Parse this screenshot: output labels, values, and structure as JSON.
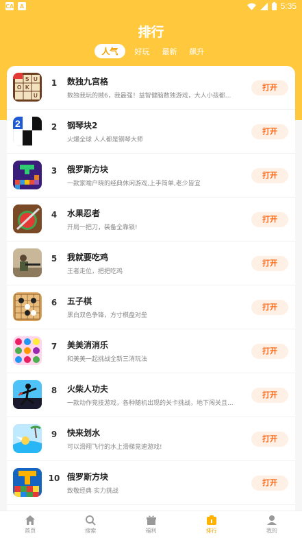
{
  "status_bar": {
    "left_icons": [
      "CA",
      "A"
    ],
    "time": "5:35"
  },
  "header": {
    "title": "排行",
    "tabs": [
      {
        "label": "人气",
        "active": true
      },
      {
        "label": "好玩",
        "active": false
      },
      {
        "label": "最新",
        "active": false
      },
      {
        "label": "飙升",
        "active": false
      }
    ]
  },
  "games": [
    {
      "rank": "1",
      "name": "数独九宫格",
      "desc": "数独我玩的贼6，我最强！益智健脑数独游戏，大人小孩都...",
      "button": "打开",
      "icon": "sudoku-icon"
    },
    {
      "rank": "2",
      "name": "钢琴块2",
      "desc": "火爆全球 人人都是钢琴大师",
      "button": "打开",
      "icon": "piano-tiles-icon"
    },
    {
      "rank": "3",
      "name": "俄罗斯方块",
      "desc": "一款家喻户晓的经典休闲游戏,上手简单,老少皆宜",
      "button": "打开",
      "icon": "tetris-icon"
    },
    {
      "rank": "4",
      "name": "水果忍者",
      "desc": "开局一把刀，装备全靠锁!",
      "button": "打开",
      "icon": "fruit-ninja-icon"
    },
    {
      "rank": "5",
      "name": "我就要吃鸡",
      "desc": "王者走位，把把吃鸡",
      "button": "打开",
      "icon": "shooter-icon"
    },
    {
      "rank": "6",
      "name": "五子棋",
      "desc": "黑白双色争锋，方寸棋盘对垒",
      "button": "打开",
      "icon": "gomoku-icon"
    },
    {
      "rank": "7",
      "name": "美美消消乐",
      "desc": "和美美一起挑战全新三消玩法",
      "button": "打开",
      "icon": "match3-icon"
    },
    {
      "rank": "8",
      "name": "火柴人功夫",
      "desc": "一款动作竞技游戏，各种随机出现的关卡挑战，地下闯关且...",
      "button": "打开",
      "icon": "stickman-icon"
    },
    {
      "rank": "9",
      "name": "快来划水",
      "desc": "可以滑翔飞行的水上滑梯竞速游戏!",
      "button": "打开",
      "icon": "water-slide-icon"
    },
    {
      "rank": "10",
      "name": "俄罗斯方块",
      "desc": "致敬经典 实力挑战",
      "button": "打开",
      "icon": "block-puzzle-icon"
    }
  ],
  "tabbar": [
    {
      "label": "首页",
      "icon": "home-icon",
      "active": false
    },
    {
      "label": "搜索",
      "icon": "search-icon",
      "active": false
    },
    {
      "label": "福利",
      "icon": "gift-icon",
      "active": false
    },
    {
      "label": "排行",
      "icon": "ranking-icon",
      "active": true
    },
    {
      "label": "我的",
      "icon": "user-icon",
      "active": false
    }
  ],
  "colors": {
    "brand_yellow": "#ffc83d",
    "button_text": "#ff6a1a",
    "button_bg": "#fff0e6",
    "active_tab": "#f0a000"
  }
}
